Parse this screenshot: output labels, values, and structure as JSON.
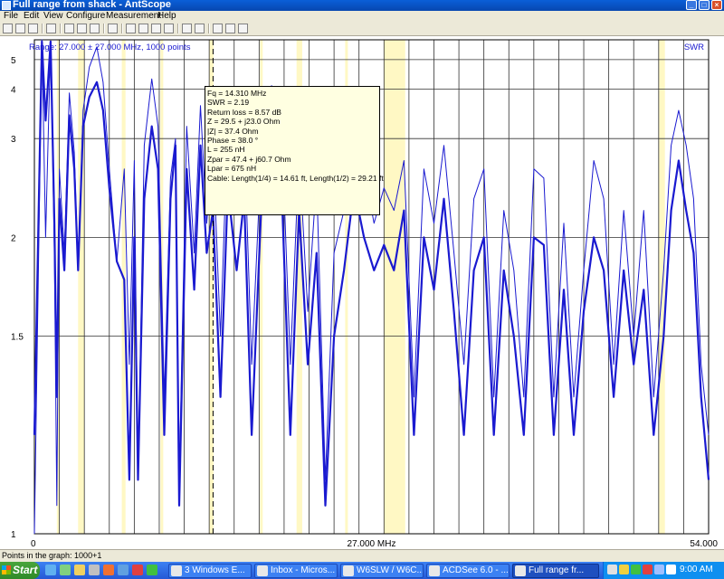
{
  "window": {
    "title": "Full range from shack - AntScope",
    "min_glyph": "_",
    "max_glyph": "□",
    "close_glyph": "×"
  },
  "menu": [
    "File",
    "Edit",
    "View",
    "Configure",
    "Measurement",
    "Help"
  ],
  "toolbar_icons": [
    "new-icon",
    "open-icon",
    "save-icon",
    "import-icon",
    "cut-icon",
    "copy-icon",
    "paste-icon",
    "print-icon",
    "scale-icon",
    "asterisk-icon",
    "refresh-icon",
    "numbers-icon",
    "filter-icon",
    "fq-icon",
    "swr-graph-icon",
    "chart-icon",
    "help-icon"
  ],
  "chart_data": {
    "type": "line",
    "range_label": "Range: 27.000 ± 27.000 MHz, 1000 points",
    "ylabel": "SWR",
    "xlim": [
      0,
      54
    ],
    "ylim": [
      1,
      6
    ],
    "x_tick_labels": [
      "0",
      "27.000 MHz",
      "54.000"
    ],
    "y_ticks": [
      1,
      1.5,
      2,
      3,
      4,
      5
    ],
    "y_tick_labels": [
      "1",
      "1.5",
      "2",
      "3",
      "4",
      "5"
    ],
    "grid": true,
    "bands": [
      [
        1.8,
        2.0
      ],
      [
        3.5,
        4.0
      ],
      [
        7.0,
        7.3
      ],
      [
        10.1,
        10.15
      ],
      [
        14.0,
        14.35
      ],
      [
        18.07,
        18.17
      ],
      [
        21.0,
        21.45
      ],
      [
        24.89,
        24.99
      ],
      [
        28.0,
        29.7
      ],
      [
        50.0,
        50.5
      ]
    ],
    "cursor_freq": 14.31,
    "colors": {
      "line": "#1a1ad0",
      "band": "#fff8c4",
      "grid": "#000000"
    },
    "series": [
      {
        "values_x": [
          0,
          0.6,
          0.9,
          1.3,
          1.6,
          1.8,
          2.0,
          2.4,
          2.8,
          3.2,
          3.5,
          3.9,
          4.4,
          5.0,
          5.5,
          6.0,
          6.6,
          7.2,
          7.6,
          8.0,
          8.3,
          8.8,
          9.4,
          9.9,
          10.4,
          10.9,
          11.3,
          11.6,
          12.2,
          12.8,
          13.3,
          13.8,
          14.3,
          14.9,
          15.5,
          16.2,
          16.8,
          17.4,
          18.2,
          19.0,
          19.8,
          20.5,
          21.2,
          21.9,
          22.6,
          23.3,
          24.0,
          24.8,
          25.6,
          26.4,
          27.2,
          28.0,
          28.8,
          29.6,
          30.4,
          31.2,
          32.0,
          32.8,
          33.6,
          34.4,
          35.2,
          36.0,
          36.8,
          37.6,
          38.4,
          39.2,
          40.0,
          40.8,
          41.6,
          42.4,
          43.2,
          44.0,
          44.8,
          45.6,
          46.4,
          47.2,
          48.0,
          48.8,
          49.6,
          50.4,
          51.0,
          51.6,
          52.2,
          52.8,
          53.4,
          54.0
        ],
        "values_y": [
          1.0,
          6.0,
          2.0,
          5.8,
          1.9,
          1.05,
          2.6,
          1.9,
          3.9,
          2.8,
          1.8,
          3.5,
          4.7,
          5.6,
          4.2,
          2.6,
          1.85,
          2.6,
          1.4,
          2.7,
          1.1,
          2.9,
          4.3,
          3.2,
          1.3,
          2.5,
          3.0,
          1.1,
          3.2,
          1.9,
          3.6,
          2.1,
          2.9,
          1.5,
          3.3,
          2.3,
          3.1,
          1.4,
          2.9,
          4.1,
          3.2,
          1.4,
          2.8,
          1.6,
          2.5,
          1.1,
          1.9,
          2.2,
          3.0,
          2.6,
          2.1,
          2.4,
          2.2,
          2.7,
          1.3,
          2.6,
          2.1,
          2.9,
          1.9,
          1.4,
          2.3,
          2.6,
          1.3,
          2.2,
          1.8,
          1.3,
          2.6,
          2.5,
          1.3,
          2.1,
          1.3,
          1.8,
          2.7,
          2.3,
          1.4,
          2.2,
          1.5,
          2.2,
          1.3,
          1.8,
          2.9,
          3.5,
          2.9,
          2.3,
          1.4,
          1.2
        ]
      },
      {
        "values_x": [
          0,
          0.6,
          0.9,
          1.3,
          1.6,
          1.8,
          2.0,
          2.4,
          2.8,
          3.2,
          3.5,
          3.9,
          4.4,
          5.0,
          5.5,
          6.0,
          6.6,
          7.2,
          7.6,
          8.0,
          8.3,
          8.8,
          9.4,
          9.9,
          10.4,
          10.9,
          11.3,
          11.6,
          12.2,
          12.8,
          13.3,
          13.8,
          14.3,
          14.9,
          15.5,
          16.2,
          16.8,
          17.4,
          18.2,
          19.0,
          19.8,
          20.5,
          21.2,
          21.9,
          22.6,
          23.3,
          24.0,
          24.8,
          25.6,
          26.4,
          27.2,
          28.0,
          28.8,
          29.6,
          30.4,
          31.2,
          32.0,
          32.8,
          33.6,
          34.4,
          35.2,
          36.0,
          36.8,
          37.6,
          38.4,
          39.2,
          40.0,
          40.8,
          41.6,
          42.4,
          43.2,
          44.0,
          44.8,
          45.6,
          46.4,
          47.2,
          48.0,
          48.8,
          49.6,
          50.4,
          51.0,
          51.6,
          52.2,
          52.8,
          53.4,
          54.0
        ],
        "values_y": [
          1.2,
          5.9,
          3.3,
          5.9,
          2.1,
          1.3,
          2.3,
          1.8,
          3.4,
          2.6,
          1.8,
          3.2,
          3.8,
          4.2,
          3.5,
          2.4,
          1.85,
          1.75,
          1.1,
          2.0,
          1.1,
          2.3,
          3.2,
          2.6,
          1.2,
          2.3,
          2.9,
          1.05,
          2.6,
          1.7,
          2.9,
          1.9,
          2.2,
          1.3,
          2.4,
          1.8,
          2.3,
          1.2,
          2.3,
          3.0,
          2.4,
          1.2,
          2.2,
          1.4,
          1.9,
          1.05,
          1.5,
          1.8,
          2.4,
          2.0,
          1.8,
          1.95,
          1.8,
          2.2,
          1.2,
          2.0,
          1.7,
          2.3,
          1.6,
          1.2,
          1.8,
          2.0,
          1.2,
          1.8,
          1.5,
          1.2,
          2.0,
          1.95,
          1.2,
          1.7,
          1.2,
          1.6,
          2.0,
          1.8,
          1.3,
          1.8,
          1.4,
          1.7,
          1.2,
          1.5,
          2.2,
          2.7,
          2.2,
          1.9,
          1.3,
          1.1
        ]
      }
    ]
  },
  "tooltip": {
    "lines": [
      "Fq = 14.310 MHz",
      "SWR = 2.19",
      "Return loss = 8.57 dB",
      "Z = 29.5 + j23.0 Ohm",
      "|Z| = 37.4 Ohm",
      "Phase = 38.0 °",
      "L = 255 nH",
      "Zpar = 47.4 + j60.7 Ohm",
      "Lpar = 675 nH",
      "Cable: Length(1/4) = 14.61 ft, Length(1/2) = 29.21 ft"
    ]
  },
  "status": {
    "text": "Points in the graph: 1000+1"
  },
  "taskbar": {
    "start": "Start",
    "tasks": [
      {
        "label": "3 Windows E...",
        "active": false
      },
      {
        "label": "Inbox - Micros...",
        "active": false
      },
      {
        "label": "W6SLW / W6C...",
        "active": false
      },
      {
        "label": "ACDSee 6.0 - ...",
        "active": false
      },
      {
        "label": "Full range fr...",
        "active": true
      }
    ],
    "clock": "9:00 AM"
  }
}
